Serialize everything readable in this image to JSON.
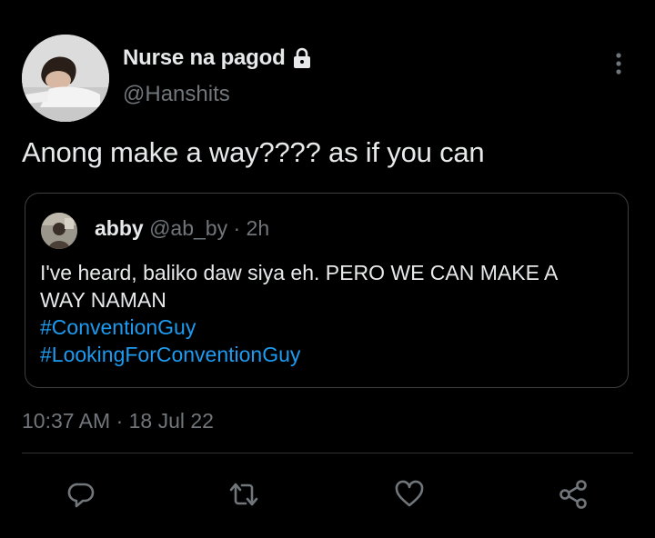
{
  "author": {
    "display_name": "Nurse na pagod",
    "handle": "@Hanshits",
    "protected_icon": "lock-icon"
  },
  "tweet": {
    "text": "Anong make a way???? as if you can",
    "timestamp": "10:37 AM · 18 Jul 22"
  },
  "quote": {
    "display_name": "abby",
    "meta": "@ab_by · 2h",
    "lines": [
      "I've heard, baliko daw siya eh. PERO WE CAN MAKE A",
      "WAY NAMAN"
    ],
    "hashtags": [
      "#ConventionGuy",
      "#LookingForConventionGuy"
    ]
  },
  "actions": {
    "reply_icon": "reply-icon",
    "retweet_icon": "retweet-icon",
    "like_icon": "like-icon",
    "share_icon": "share-icon",
    "more_icon": "more-options-icon"
  },
  "colors": {
    "background": "#000000",
    "text": "#e7e9ea",
    "muted": "#71767b",
    "link": "#1d9bf0",
    "border": "#3c4043"
  }
}
